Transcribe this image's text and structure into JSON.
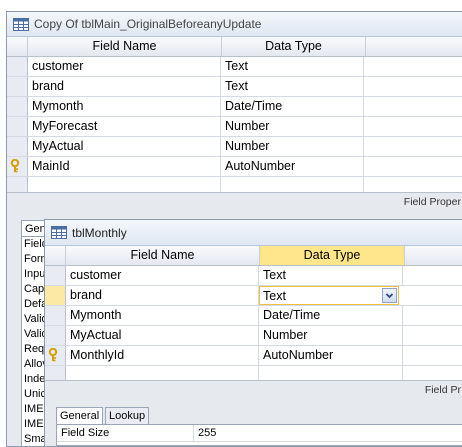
{
  "window_back": {
    "title": "Copy Of tblMain_OriginalBeforeanyUpdate",
    "columns": {
      "field_name": "Field Name",
      "data_type": "Data Type"
    },
    "rows": [
      {
        "field": "customer",
        "type": "Text"
      },
      {
        "field": "brand",
        "type": "Text"
      },
      {
        "field": "Mymonth",
        "type": "Date/Time"
      },
      {
        "field": "MyForecast",
        "type": "Number"
      },
      {
        "field": "MyActual",
        "type": "Number"
      },
      {
        "field": "MainId",
        "type": "AutoNumber",
        "primary_key": true
      }
    ],
    "field_properties_label": "Field Proper",
    "props_tab_label": "Gen",
    "props_labels": [
      "Field",
      "Form",
      "Inpu",
      "Capt",
      "Defa",
      "Valid",
      "Valid",
      "Requ",
      "Allov",
      "Inde",
      "Unic",
      "IME",
      "IME",
      "Sma"
    ]
  },
  "window_front": {
    "title": "tblMonthly",
    "columns": {
      "field_name": "Field Name",
      "data_type": "Data Type"
    },
    "rows": [
      {
        "field": "customer",
        "type": "Text"
      },
      {
        "field": "brand",
        "type": "Text",
        "selected": true
      },
      {
        "field": "Mymonth",
        "type": "Date/Time"
      },
      {
        "field": "MyActual",
        "type": "Number"
      },
      {
        "field": "MonthlyId",
        "type": "AutoNumber",
        "primary_key": true
      }
    ],
    "field_properties_label": "Field Pr",
    "tabs": {
      "general": "General",
      "lookup": "Lookup"
    },
    "field_size_label": "Field Size",
    "field_size_value": "255"
  },
  "colors": {
    "selected_header": "#ffe68a",
    "selected_row": "#fde9a6",
    "key_icon": "#e0b000"
  }
}
